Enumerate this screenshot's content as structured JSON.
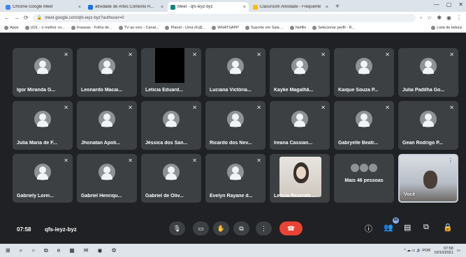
{
  "browser": {
    "tabs": [
      {
        "label": "Chrome Google Meet",
        "favicon": "#4285f4",
        "active": false
      },
      {
        "label": "atividade de Artes Contexto R...",
        "favicon": "#1a73e8",
        "active": false
      },
      {
        "label": "Meet - qfs-ieyz-byz",
        "favicon": "#00897b",
        "active": true
      },
      {
        "label": "Classroom Atividade - Frequente",
        "favicon": "#fbbc04",
        "active": false
      }
    ],
    "close_glyph": "×",
    "new_tab_glyph": "+",
    "window_controls": [
      "—",
      "▢",
      "✕"
    ],
    "url": "meet.google.com/qfs-ieyz-byz?authuser=0",
    "bookmarks": [
      "Apps",
      "UOL - o melhor co...",
      "Fraseas - Folha de...",
      "TV ao vivo - Canal...",
      "Planet - Uma rfc@...",
      "WHATSAPP",
      "Suporte em Sala ...",
      "Netflix",
      "Selecionar perfil - R..."
    ],
    "bookmarks_right": "Lista de leitura"
  },
  "meet": {
    "tiles": [
      {
        "name": "Igor Miranda G...",
        "type": "avatar",
        "muted": true
      },
      {
        "name": "Leonardo Macai...",
        "type": "avatar",
        "muted": true
      },
      {
        "name": "Leticia Eduard...",
        "type": "black",
        "muted": true
      },
      {
        "name": "Luciana Victória...",
        "type": "avatar",
        "muted": true
      },
      {
        "name": "Kayke Magalhã...",
        "type": "avatar",
        "muted": true
      },
      {
        "name": "Kaique Souza P...",
        "type": "avatar",
        "muted": true
      },
      {
        "name": "Julia Padilha Go...",
        "type": "avatar",
        "muted": true
      },
      {
        "name": "Julia Maria de F...",
        "type": "avatar",
        "muted": true
      },
      {
        "name": "Jhonatan Apoli...",
        "type": "avatar",
        "muted": true
      },
      {
        "name": "Jéssica dos San...",
        "type": "avatar",
        "muted": true
      },
      {
        "name": "Ricardo dos Nev...",
        "type": "avatar",
        "muted": true
      },
      {
        "name": "Ireana Cassian...",
        "type": "avatar",
        "muted": true
      },
      {
        "name": "Gabryelle Beatr...",
        "type": "avatar",
        "muted": true
      },
      {
        "name": "Gean Rodrigo P...",
        "type": "avatar",
        "muted": true
      },
      {
        "name": "Gabriely Lorei...",
        "type": "avatar",
        "muted": true
      },
      {
        "name": "Gabriel Henriqu...",
        "type": "avatar",
        "muted": true
      },
      {
        "name": "Gabriel de Oliv...",
        "type": "avatar",
        "muted": true
      },
      {
        "name": "Evelyn Rayane d...",
        "type": "avatar",
        "muted": true
      },
      {
        "name": "Leticia Rezende ...",
        "type": "photo",
        "muted": false
      },
      {
        "name": "Mais 46 pessoas",
        "type": "more",
        "muted": false
      },
      {
        "name": "Você",
        "type": "self",
        "muted": false
      }
    ],
    "mic_off_glyph": "✕",
    "self_menu_glyph": "⋮",
    "time": "07:58",
    "meeting_code": "qfs-ieyz-byz",
    "controls": [
      {
        "name": "mic-button",
        "glyph": "🎙"
      },
      {
        "name": "camera-button",
        "glyph": "▭"
      },
      {
        "name": "raise-hand-button",
        "glyph": "✋"
      },
      {
        "name": "present-button",
        "glyph": "⧉"
      },
      {
        "name": "more-options-button",
        "glyph": "⋮"
      },
      {
        "name": "leave-call-button",
        "glyph": "☎"
      }
    ],
    "right_controls": [
      {
        "name": "meeting-details-icon",
        "glyph": "ⓘ"
      },
      {
        "name": "people-icon",
        "glyph": "👥"
      },
      {
        "name": "chat-icon",
        "glyph": "▤"
      },
      {
        "name": "activities-icon",
        "glyph": "⧉"
      },
      {
        "name": "host-controls-icon",
        "glyph": "🔒"
      }
    ],
    "participants_badge": "66"
  },
  "taskbar": {
    "icons": [
      "⊞",
      "⌕",
      "○",
      "⧉",
      "e",
      "▦",
      "✉",
      "◉",
      "⚙"
    ],
    "tray": "^ ☁ ▭ 🔊 POR",
    "clock_time": "07:58",
    "clock_date": "19/10/2021",
    "notification_glyph": "▭"
  }
}
